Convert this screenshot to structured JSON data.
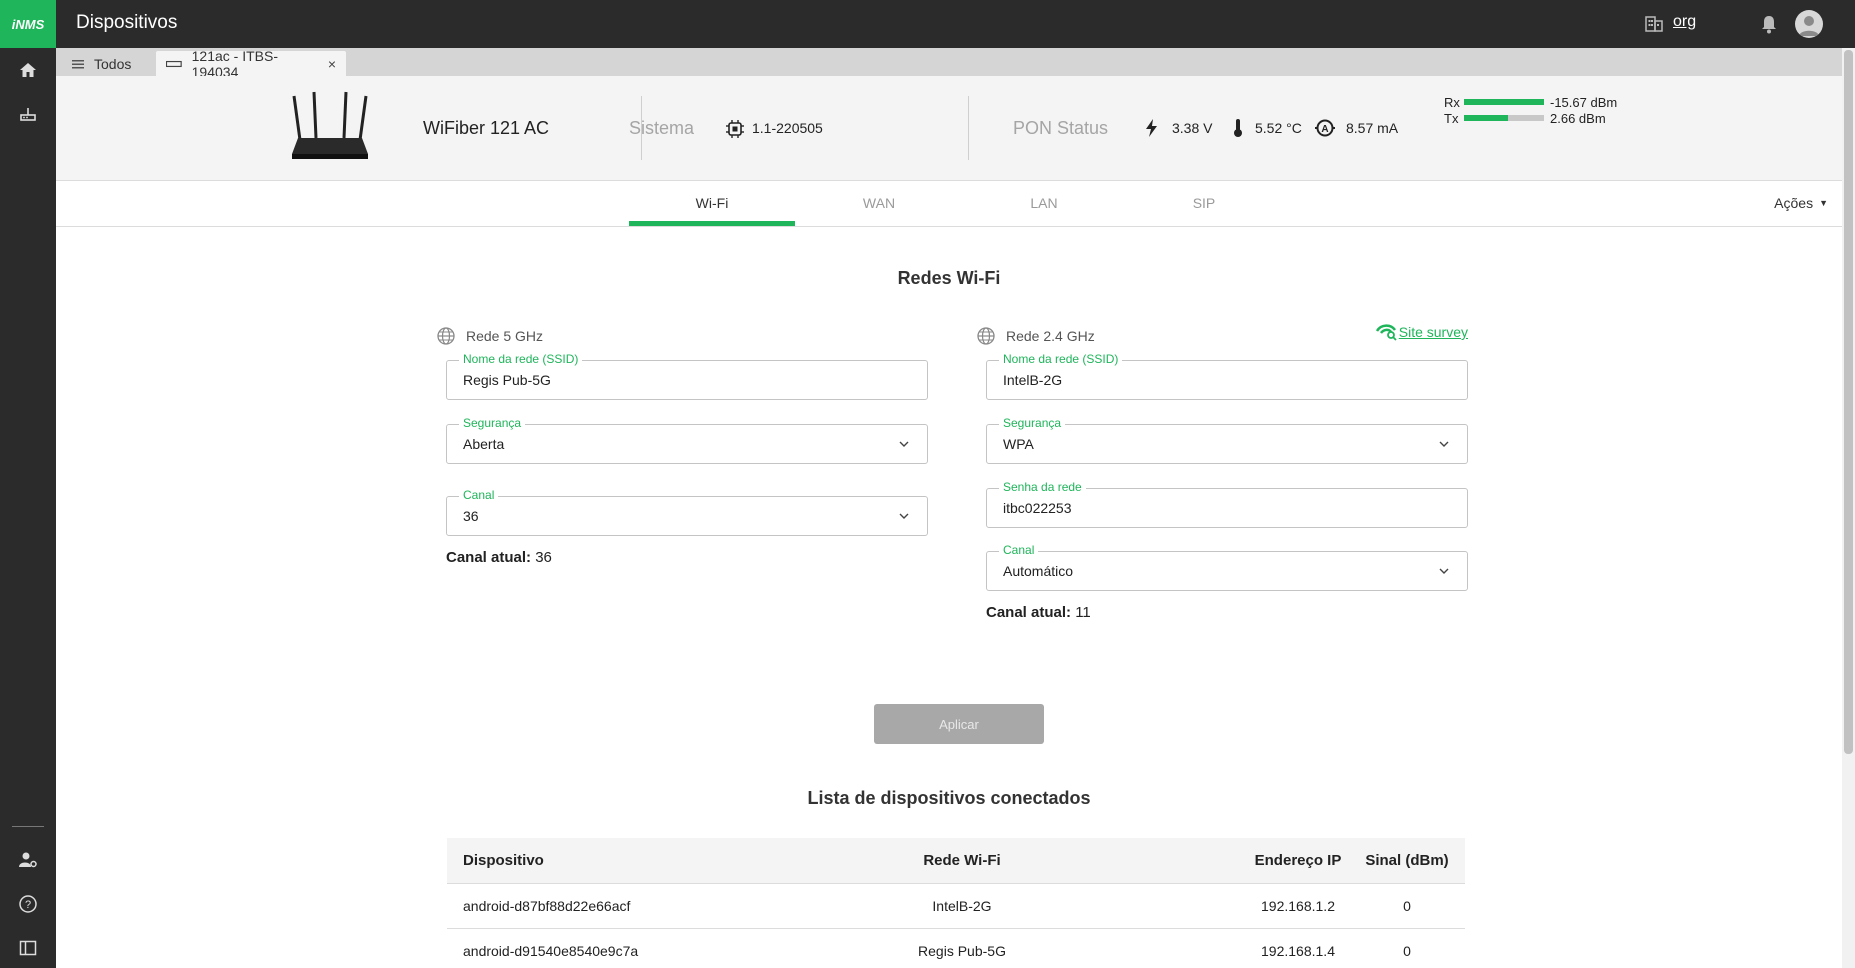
{
  "app": {
    "logo": "iNMS",
    "title": "Dispositivos",
    "org": "org"
  },
  "tabs": {
    "all_label": "Todos",
    "device_label": "121ac - ITBS-194034",
    "close_glyph": "×"
  },
  "device": {
    "model": "WiFiber 121 AC",
    "system_label": "Sistema",
    "firmware": "1.1-220505",
    "pon_label": "PON Status",
    "voltage": "3.38 V",
    "temperature": "5.52 °C",
    "current": "8.57 mA",
    "rx_label": "Rx",
    "rx_value": "-15.67 dBm",
    "rx_level": 1.0,
    "tx_label": "Tx",
    "tx_value": "2.66 dBm",
    "tx_level": 0.55
  },
  "subtabs": {
    "wifi": "Wi-Fi",
    "wan": "WAN",
    "lan": "LAN",
    "sip": "SIP",
    "actions": "Ações"
  },
  "wifi": {
    "title": "Redes Wi-Fi",
    "net5": {
      "heading": "Rede 5 GHz",
      "ssid_label": "Nome da rede (SSID)",
      "ssid": "Regis Pub-5G",
      "security_label": "Segurança",
      "security": "Aberta",
      "channel_label": "Canal",
      "channel": "36",
      "current_label": "Canal atual:",
      "current": "36"
    },
    "net24": {
      "heading": "Rede 2.4 GHz",
      "survey": "Site survey",
      "ssid_label": "Nome da rede (SSID)",
      "ssid": "IntelB-2G",
      "security_label": "Segurança",
      "security": "WPA",
      "password_label": "Senha da rede",
      "password": "itbc022253",
      "channel_label": "Canal",
      "channel": "Automático",
      "current_label": "Canal atual:",
      "current": "11"
    },
    "apply": "Aplicar"
  },
  "devices": {
    "title": "Lista de dispositivos conectados",
    "headers": [
      "Dispositivo",
      "Rede Wi-Fi",
      "Endereço IP",
      "Sinal (dBm)"
    ],
    "rows": [
      [
        "android-d87bf88d22e66acf",
        "IntelB-2G",
        "192.168.1.2",
        "0"
      ],
      [
        "android-d91540e8540e9c7a",
        "Regis Pub-5G",
        "192.168.1.4",
        "0"
      ]
    ]
  },
  "colors": {
    "accent": "#1fb55a",
    "topbar": "#2b2b2b"
  }
}
